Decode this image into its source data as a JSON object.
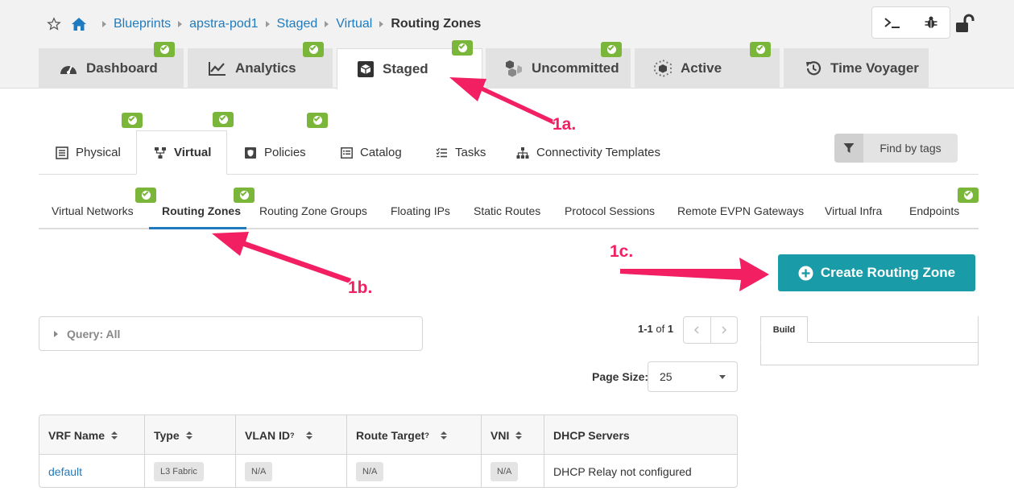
{
  "breadcrumb": [
    "Blueprints",
    "apstra-pod1",
    "Staged",
    "Virtual"
  ],
  "breadcrumb_current": "Routing Zones",
  "main_tabs": [
    {
      "label": "Dashboard",
      "icon": "speedometer-icon"
    },
    {
      "label": "Analytics",
      "icon": "chart-line-icon"
    },
    {
      "label": "Staged",
      "icon": "cube-icon",
      "active": true
    },
    {
      "label": "Uncommitted",
      "icon": "cubes-icon"
    },
    {
      "label": "Active",
      "icon": "active-cube-icon"
    },
    {
      "label": "Time Voyager",
      "icon": "history-icon"
    }
  ],
  "sub_tabs": [
    {
      "label": "Physical",
      "icon": "server-icon"
    },
    {
      "label": "Virtual",
      "icon": "network-icon",
      "active": true
    },
    {
      "label": "Policies",
      "icon": "shield-icon"
    },
    {
      "label": "Catalog",
      "icon": "list-box-icon"
    },
    {
      "label": "Tasks",
      "icon": "tasks-icon"
    },
    {
      "label": "Connectivity Templates",
      "icon": "sitemap-icon"
    }
  ],
  "find_by_tags": "Find by tags",
  "third_tabs": [
    {
      "label": "Virtual Networks"
    },
    {
      "label": "Routing Zones",
      "active": true
    },
    {
      "label": "Routing Zone Groups"
    },
    {
      "label": "Floating IPs"
    },
    {
      "label": "Static Routes"
    },
    {
      "label": "Protocol Sessions"
    },
    {
      "label": "Remote EVPN Gateways"
    },
    {
      "label": "Virtual Infra"
    },
    {
      "label": "Endpoints"
    }
  ],
  "create_button": "Create Routing Zone",
  "query": "Query: All",
  "pagination": {
    "range": "1-1",
    "of_word": "of",
    "total": "1"
  },
  "page_size": {
    "label": "Page Size:",
    "value": "25"
  },
  "build_tab": "Build",
  "table": {
    "headers": [
      "VRF Name",
      "Type",
      "VLAN ID",
      "Route Target",
      "VNI",
      "DHCP Servers"
    ],
    "help_mark": "?",
    "rows": [
      {
        "vrf_name": "default",
        "type": "L3 Fabric",
        "vlan_id": "N/A",
        "route_target": "N/A",
        "vni": "N/A",
        "dhcp": "DHCP Relay not configured"
      }
    ]
  },
  "annotations": [
    "1a.",
    "1b.",
    "1c."
  ],
  "colors": {
    "accent": "#1f7bbf",
    "create": "#1a9ca8",
    "ok": "#79b639",
    "annotation": "#f21f63"
  }
}
